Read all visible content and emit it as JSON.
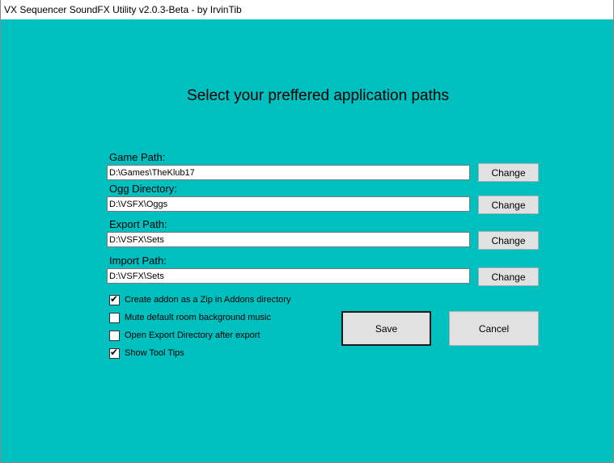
{
  "window": {
    "title": "VX Sequencer SoundFX Utility v2.0.3-Beta - by IrvinTib",
    "background_color": "#00bfbf"
  },
  "heading": "Select your preffered application paths",
  "paths": [
    {
      "label": "Game Path:",
      "value": "D:\\Games\\TheKlub17",
      "button": "Change"
    },
    {
      "label": "Ogg Directory:",
      "value": "D:\\VSFX\\Oggs",
      "button": "Change"
    },
    {
      "label": "Export Path:",
      "value": "D:\\VSFX\\Sets",
      "button": "Change"
    },
    {
      "label": "Import Path:",
      "value": "D:\\VSFX\\Sets",
      "button": "Change"
    }
  ],
  "options": [
    {
      "label": "Create addon as a Zip in Addons directory",
      "checked": true
    },
    {
      "label": "Mute default room background music",
      "checked": false
    },
    {
      "label": "Open Export Directory after export",
      "checked": false
    },
    {
      "label": "Show Tool Tips",
      "checked": true
    }
  ],
  "actions": {
    "save_label": "Save",
    "cancel_label": "Cancel"
  },
  "check_glyph": "✔"
}
